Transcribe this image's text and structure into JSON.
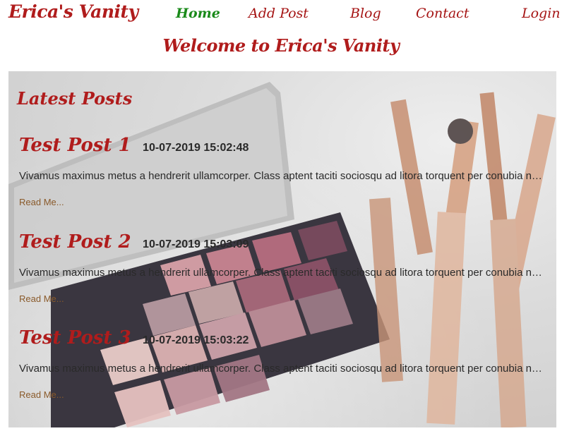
{
  "brand": "Erica's Vanity",
  "nav": [
    {
      "label": "Home",
      "active": true
    },
    {
      "label": "Add Post",
      "active": false
    },
    {
      "label": "Blog",
      "active": false
    },
    {
      "label": "Contact",
      "active": false
    },
    {
      "label": "Login",
      "active": false
    }
  ],
  "welcome": "Welcome to Erica's Vanity",
  "latest_heading": "Latest Posts",
  "posts": [
    {
      "title": "Test Post 1",
      "date": "10-07-2019 15:02:48",
      "excerpt": "Vivamus maximus metus a hendrerit ullamcorper. Class aptent taciti sociosqu ad litora torquent per conubia nostra",
      "read_more": "Read Me..."
    },
    {
      "title": "Test Post 2",
      "date": "10-07-2019 15:03:09",
      "excerpt": "Vivamus maximus metus a hendrerit ullamcorper. Class aptent taciti sociosqu ad litora torquent per conubia nostra",
      "read_more": "Read Me..."
    },
    {
      "title": "Test Post 3",
      "date": "10-07-2019 15:03:22",
      "excerpt": "Vivamus maximus metus a hendrerit ullamcorper. Class aptent taciti sociosqu ad litora torquent per conubia nostra",
      "read_more": "Read Me..."
    }
  ],
  "colors": {
    "brand": "#b01c1c",
    "active_nav": "#1a8a1a",
    "link": "#8a5a2a"
  }
}
